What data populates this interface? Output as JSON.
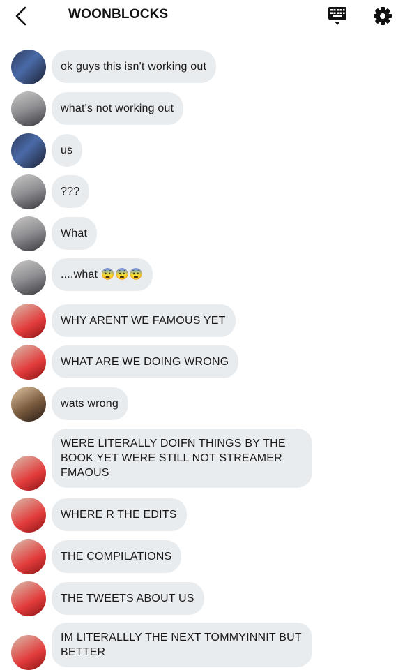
{
  "header": {
    "title": "WOONBLOCKS",
    "back_icon": "chevron-left-icon",
    "keyboard_icon": "keyboard-icon",
    "settings_icon": "gear-icon"
  },
  "messages": [
    {
      "text": "ok guys this isn't working out",
      "avatar": "a"
    },
    {
      "text": "what's not working out",
      "avatar": "b"
    },
    {
      "text": "us",
      "avatar": "a"
    },
    {
      "text": "???",
      "avatar": "b"
    },
    {
      "text": "What",
      "avatar": "b"
    },
    {
      "text": "....what 😨😨😨",
      "avatar": "b"
    },
    {
      "text": "WHY ARENT WE FAMOUS YET",
      "avatar": "c"
    },
    {
      "text": "WHAT ARE WE DOING WRONG",
      "avatar": "c"
    },
    {
      "text": "wats wrong",
      "avatar": "d"
    },
    {
      "text": "WERE LITERALLY DOIFN THINGS BY THE BOOK YET WERE STILL NOT STREAMER FMAOUS",
      "avatar": "c"
    },
    {
      "text": "WHERE R THE EDITS",
      "avatar": "c"
    },
    {
      "text": "THE COMPILATIONS",
      "avatar": "c"
    },
    {
      "text": "THE TWEETS ABOUT US",
      "avatar": "c"
    },
    {
      "text": "IM LITERALLLY THE NEXT TOMMYINNIT BUT BETTER",
      "avatar": "c"
    }
  ]
}
